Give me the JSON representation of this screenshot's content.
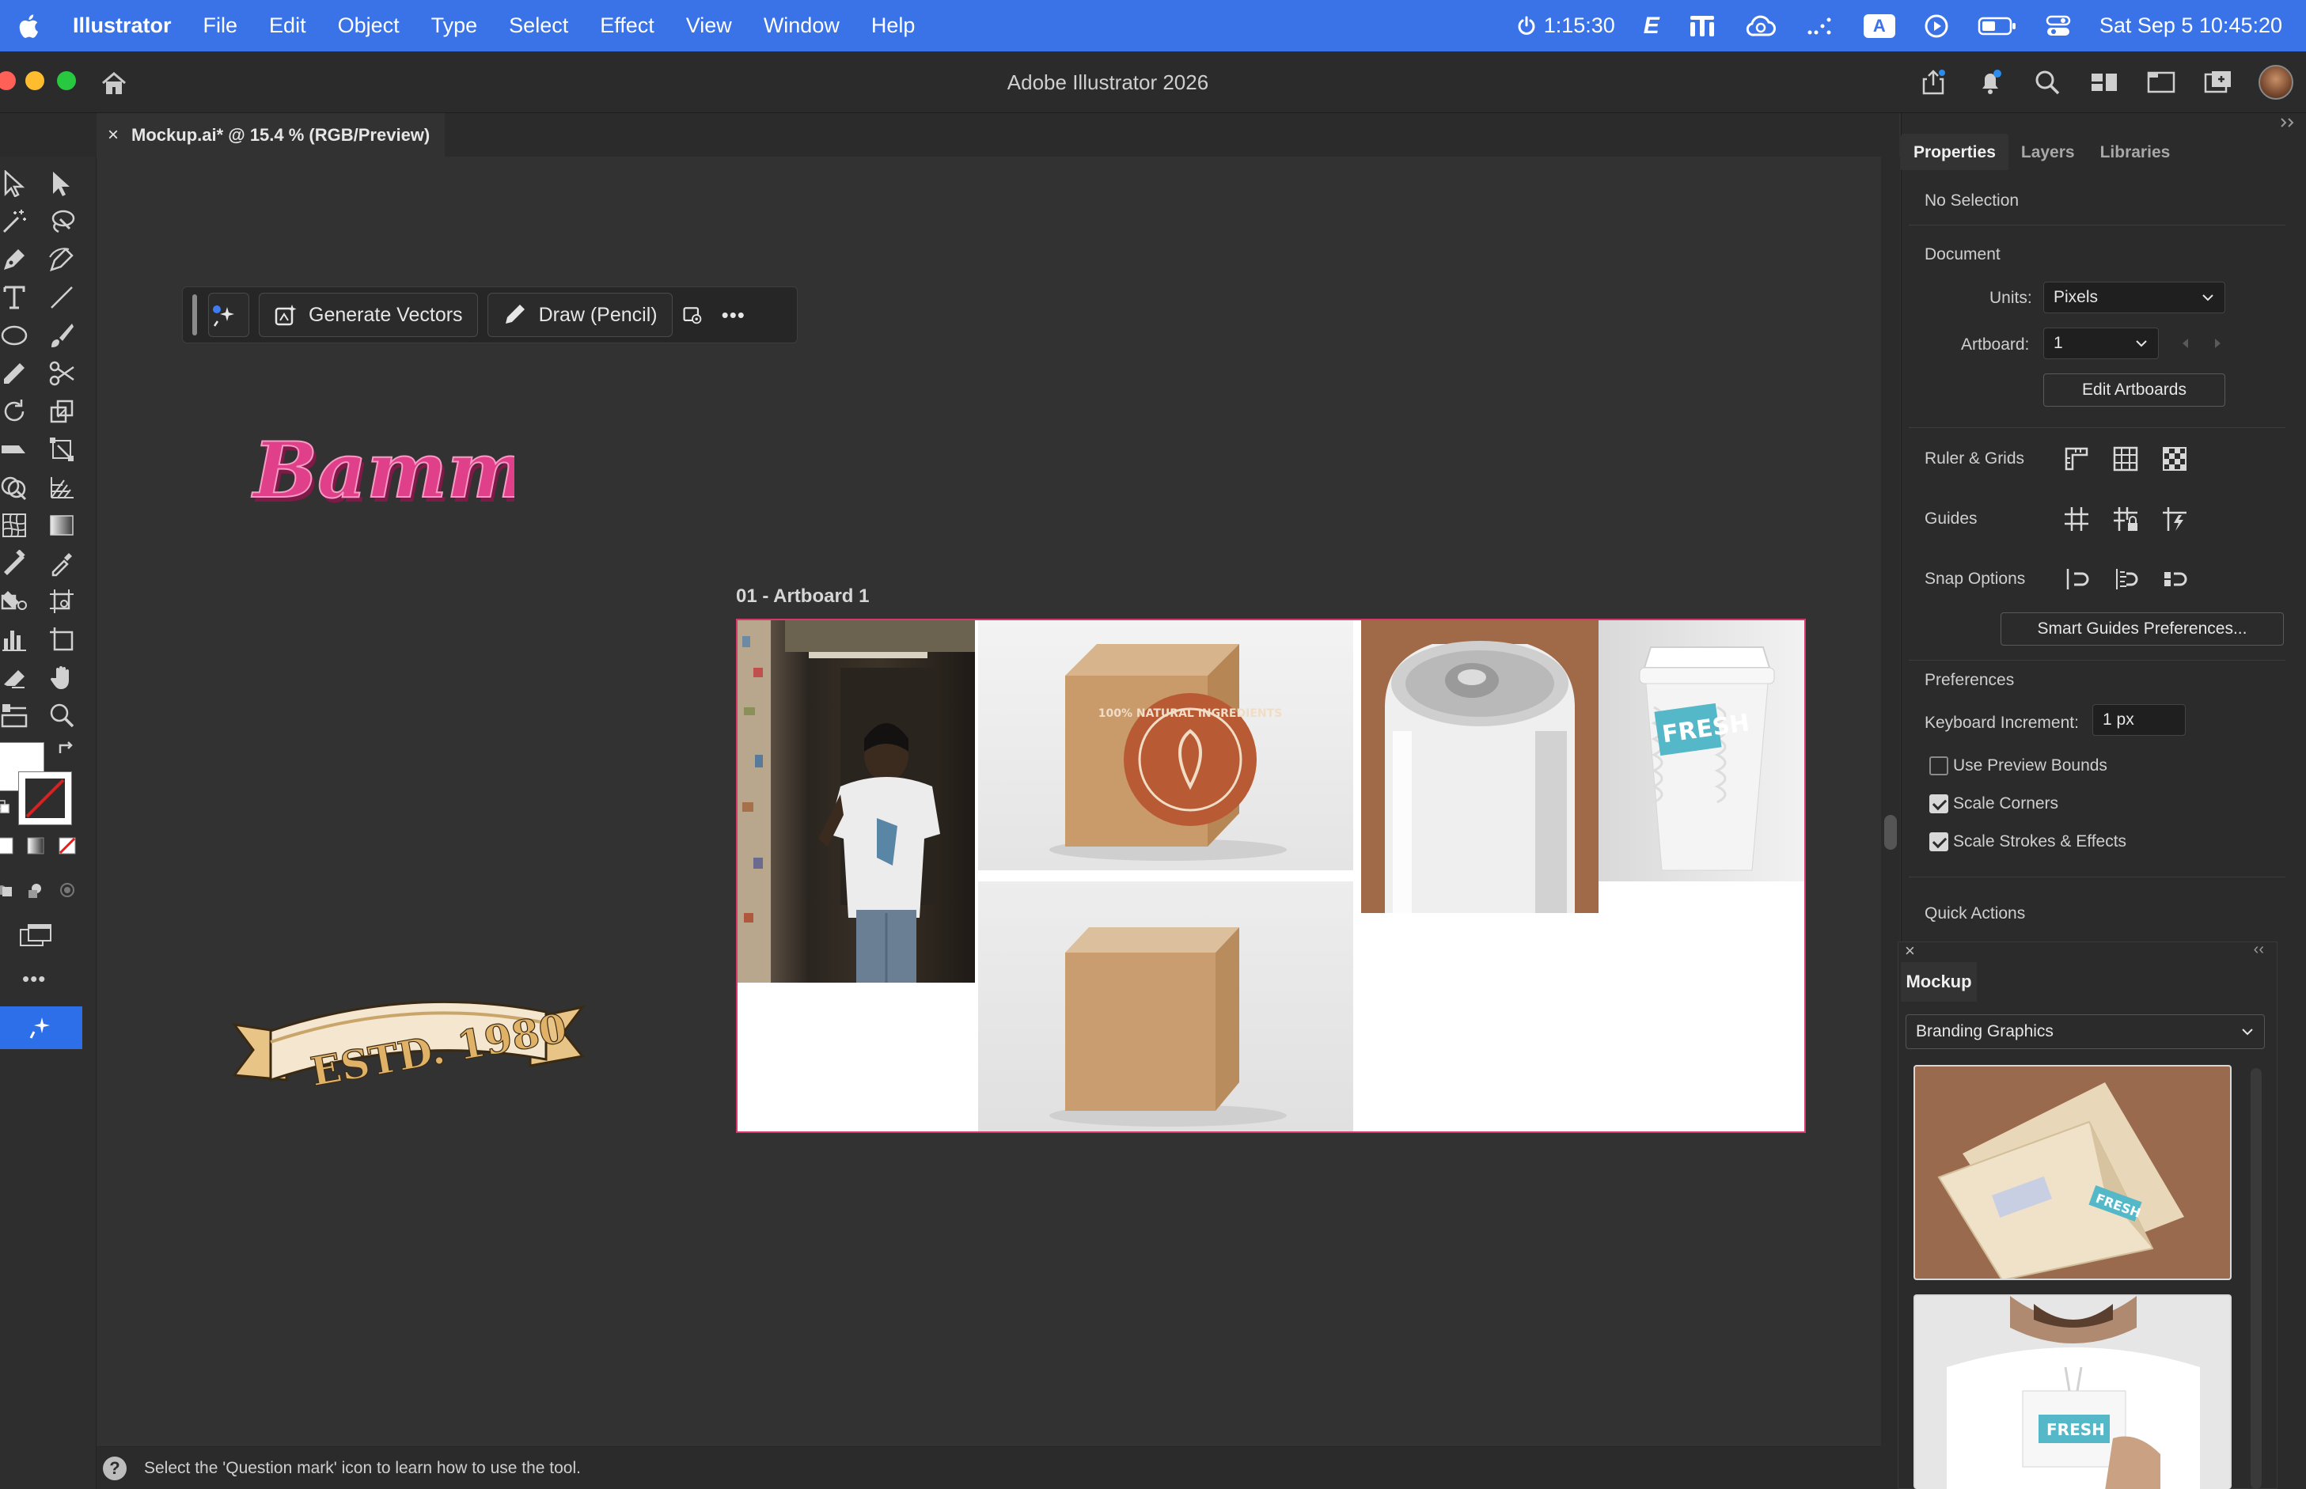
{
  "menubar": {
    "app_name": "Illustrator",
    "menus": [
      "File",
      "Edit",
      "Object",
      "Type",
      "Select",
      "Effect",
      "View",
      "Window",
      "Help"
    ],
    "timer": "1:15:30",
    "input_badge": "A",
    "datetime": "Sat Sep 5  10:45:20",
    "color": "#3a72e8"
  },
  "window": {
    "title": "Adobe Illustrator 2026",
    "traffic_colors": [
      "#fe5f57",
      "#febc2e",
      "#28c840"
    ]
  },
  "document_tab": {
    "close_label": "×",
    "label": "Mockup.ai* @ 15.4 % (RGB/Preview)"
  },
  "context_bar": {
    "generate_label": "Generate Vectors",
    "draw_label": "Draw (Pencil)",
    "more_label": "•••"
  },
  "canvas": {
    "artboard_label": "01 - Artboard 1",
    "artboard_border_color": "#d9386f",
    "sticker_text": "Bamm!",
    "banner_text": "ESTD. 1980",
    "box_stamp_text": "100% NATURAL INGREDIENTS",
    "cup_text": "FRESH"
  },
  "status_bar": {
    "help_glyph": "?",
    "text": "Select the 'Question mark' icon to learn how to use the tool."
  },
  "toolbar": {
    "more_label": "•••"
  },
  "panel": {
    "tabs": [
      "Properties",
      "Layers",
      "Libraries"
    ],
    "selection": "No Selection",
    "document_heading": "Document",
    "units_label": "Units:",
    "units_value": "Pixels",
    "artboard_label": "Artboard:",
    "artboard_value": "1",
    "edit_artboards": "Edit Artboards",
    "ruler_grids": "Ruler & Grids",
    "guides": "Guides",
    "snap_options": "Snap Options",
    "smart_guides_btn": "Smart Guides Preferences...",
    "preferences_heading": "Preferences",
    "keyboard_increment_label": "Keyboard Increment:",
    "keyboard_increment_value": "1 px",
    "checkboxes": [
      {
        "label": "Use Preview Bounds",
        "checked": false
      },
      {
        "label": "Scale Corners",
        "checked": true
      },
      {
        "label": "Scale Strokes & Effects",
        "checked": true
      }
    ],
    "quick_actions": "Quick Actions"
  },
  "mockup_panel": {
    "close_label": "×",
    "collapse_label": "‹‹",
    "tab": "Mockup",
    "category": "Branding Graphics",
    "card_text": "FRESH"
  }
}
